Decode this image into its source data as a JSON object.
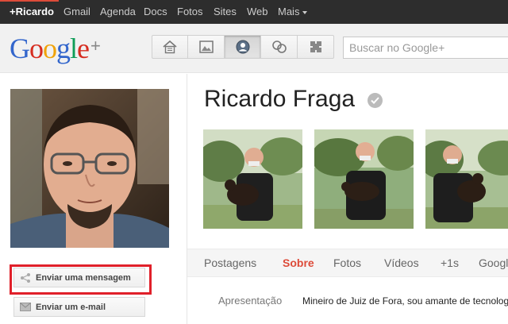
{
  "topbar": {
    "items": [
      "+Ricardo",
      "Gmail",
      "Agenda",
      "Docs",
      "Fotos",
      "Sites",
      "Web",
      "Mais"
    ]
  },
  "header": {
    "logo_text": "Google",
    "logo_plus": "+",
    "nav_icons": [
      "home-icon",
      "photos-icon",
      "profile-icon",
      "circles-icon",
      "games-icon"
    ],
    "search_placeholder": "Buscar no Google+"
  },
  "profile": {
    "name": "Ricardo Fraga",
    "send_message_label": "Enviar uma mensagem",
    "send_email_label": "Enviar um e-mail"
  },
  "tabs": [
    "Postagens",
    "Sobre",
    "Fotos",
    "Vídeos",
    "+1s",
    "Google"
  ],
  "active_tab": "Sobre",
  "about": {
    "label": "Apresentação",
    "value": "Mineiro de Juiz de Fora, sou amante de tecnologia"
  },
  "colors": {
    "accent": "#dd4b39",
    "topbar": "#2d2d2d",
    "highlight": "#e0202a"
  }
}
